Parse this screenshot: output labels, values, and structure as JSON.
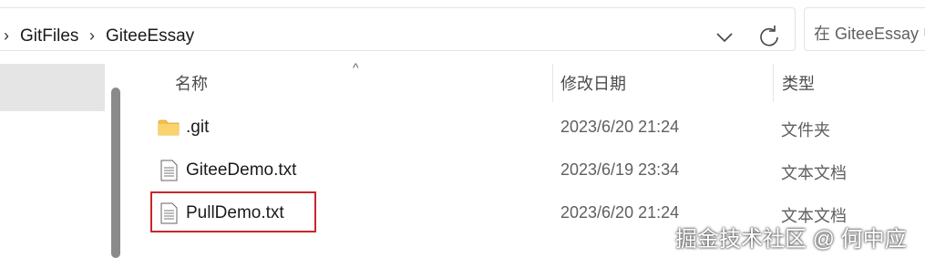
{
  "address_bar": {
    "path": [
      "GitFiles",
      "GiteeEssay"
    ],
    "separator": "›"
  },
  "search": {
    "placeholder": "在 GiteeEssay 中"
  },
  "columns": {
    "name": "名称",
    "date": "修改日期",
    "type": "类型"
  },
  "files": [
    {
      "name": ".git",
      "date": "2023/6/20 21:24",
      "type": "文件夹",
      "icon": "folder-icon"
    },
    {
      "name": "GiteeDemo.txt",
      "date": "2023/6/19 23:34",
      "type": "文本文档",
      "icon": "text-file-icon"
    },
    {
      "name": "PullDemo.txt",
      "date": "2023/6/20 21:24",
      "type": "文本文档",
      "icon": "text-file-icon"
    }
  ],
  "watermark": "掘金技术社区 @ 何中应",
  "colors": {
    "highlight_border": "#c8262b",
    "nav_selected": "#e5e5e5",
    "folder": "#f5c04a"
  }
}
